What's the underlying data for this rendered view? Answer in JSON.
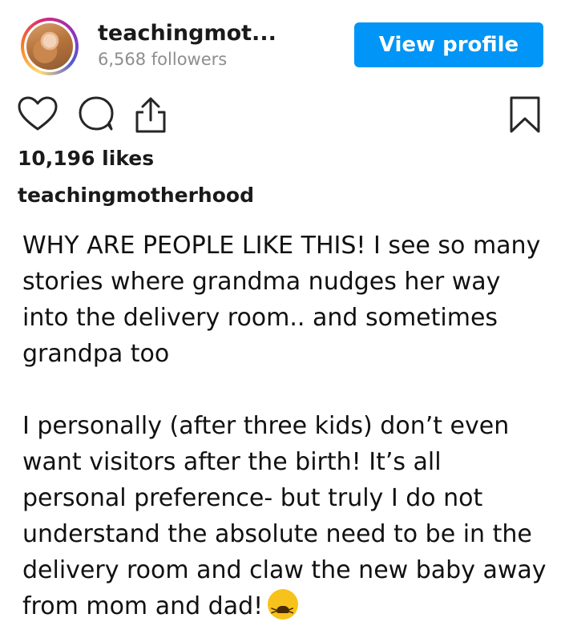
{
  "post": {
    "username": "teachingmot...",
    "followers": "6,568 followers",
    "view_profile_label": "View profile",
    "likes": "10,196 likes",
    "caption_username": "teachingmotherhood",
    "caption_paragraphs": [
      "WHY ARE PEOPLE LIKE THIS! I see so many stories where grandma nudges her way into the delivery room.. and sometimes grandpa too",
      "I personally (after three kids) don’t even want visitors after the birth! It’s all personal preference- but truly I do not understand the absolute need to be in the delivery room and claw the new baby away from mom and dad!"
    ],
    "caption_emoji": "tired-face-emoji"
  },
  "icons": {
    "like": "heart-icon",
    "comment": "comment-bubble-icon",
    "share": "share-icon",
    "save": "bookmark-icon"
  },
  "colors": {
    "button_blue": "#0095f6",
    "muted_text": "#8e8e8e",
    "text": "#111111"
  }
}
